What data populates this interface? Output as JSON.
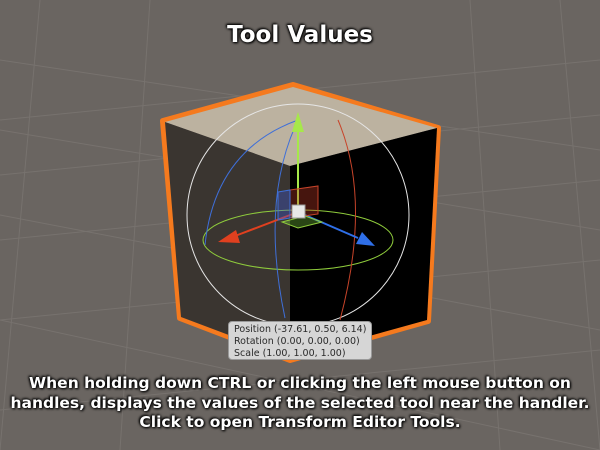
{
  "title": "Tool Values",
  "tooltip": {
    "position": "Position (-37.61, 0.50, 6.14)",
    "rotation": "Rotation (0.00, 0.00, 0.00)",
    "scale": "Scale (1.00, 1.00, 1.00)"
  },
  "caption": {
    "line1": "When holding down CTRL or clicking the left mouse button on",
    "line2": "handles, displays the values of the selected tool near the handler.",
    "line3": "Click to open Transform Editor Tools."
  },
  "colors": {
    "background": "#6a6561",
    "grid": "#7a7571",
    "selection_outline": "#f57a1e",
    "cube_top": "#bfb5a3",
    "cube_left": "#3b3631",
    "cube_right": "#000000",
    "axis_x": "#e0401f",
    "axis_y": "#a6e84a",
    "axis_z": "#2f6fe8"
  },
  "icons": [
    "move-gizmo-icon",
    "rotation-sphere-icon",
    "center-cube-icon"
  ]
}
